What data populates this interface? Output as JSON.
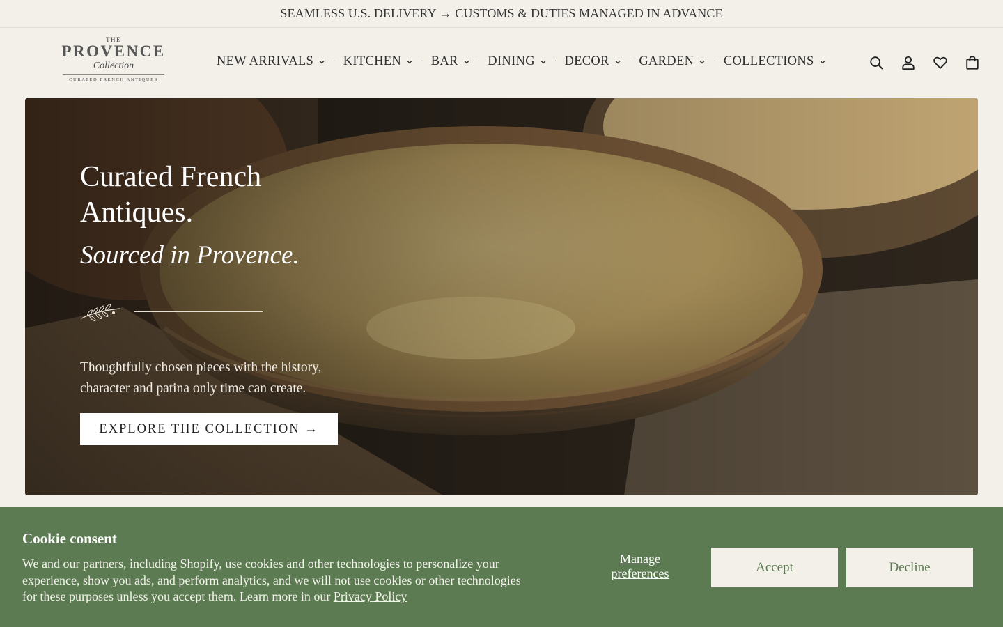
{
  "announcement": "SEAMLESS U.S. DELIVERY → CUSTOMS & DUTIES MANAGED IN ADVANCE",
  "logo": {
    "the": "THE",
    "word": "PROVENCE",
    "sub": "Collection",
    "tagline": "CURATED FRENCH ANTIQUES"
  },
  "nav": {
    "items": [
      {
        "label": "NEW ARRIVALS"
      },
      {
        "label": "KITCHEN"
      },
      {
        "label": "BAR"
      },
      {
        "label": "DINING"
      },
      {
        "label": "DECOR"
      },
      {
        "label": "GARDEN"
      },
      {
        "label": "COLLECTIONS"
      }
    ],
    "separator": "·"
  },
  "header_icons": [
    "search-icon",
    "account-icon",
    "wishlist-heart-icon",
    "cart-bag-icon"
  ],
  "hero": {
    "title": "Curated French Antiques.",
    "subtitle": "Sourced in Provence.",
    "description": "Thoughtfully chosen pieces with the history, character and patina only time can create.",
    "cta": "EXPLORE THE COLLECTION →"
  },
  "cookie": {
    "title": "Cookie consent",
    "text": "We and our partners, including Shopify, use cookies and other technologies to personalize your experience, show you ads, and perform analytics, and we will not use cookies or other technologies for these purposes unless you accept them. Learn more in our ",
    "privacy_link": "Privacy Policy",
    "manage": "Manage preferences",
    "accept": "Accept",
    "decline": "Decline"
  },
  "colors": {
    "background": "#f3f0ea",
    "cookie_bar": "#5d7b52",
    "text": "#2f2f2f"
  }
}
